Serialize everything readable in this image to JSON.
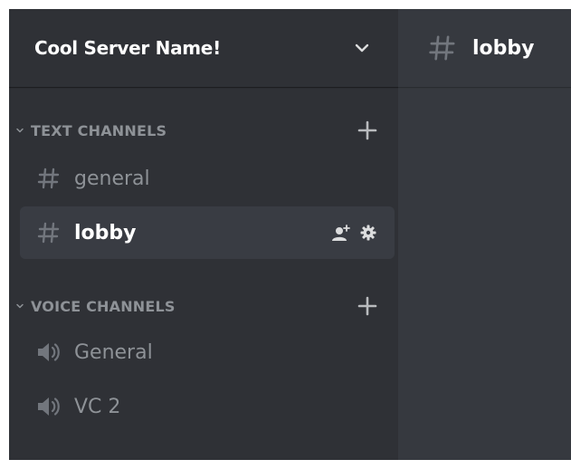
{
  "server": {
    "name": "Cool Server Name!"
  },
  "categories": [
    {
      "label": "TEXT CHANNELS",
      "channels": [
        {
          "name": "general",
          "icon": "hash-icon",
          "active": false
        },
        {
          "name": "lobby",
          "icon": "hash-icon",
          "active": true
        }
      ]
    },
    {
      "label": "VOICE CHANNELS",
      "channels": [
        {
          "name": "General",
          "icon": "speaker-icon",
          "active": false
        },
        {
          "name": "VC 2",
          "icon": "speaker-icon",
          "active": false
        }
      ]
    }
  ],
  "main": {
    "channel_title": "lobby",
    "icon": "hash-icon"
  },
  "colors": {
    "sidebar_bg": "#2f3136",
    "main_bg": "#36393f",
    "active_channel_bg": "#393c43",
    "muted_text": "#8e9297",
    "icon_color": "#72767d",
    "text_white": "#ffffff"
  }
}
